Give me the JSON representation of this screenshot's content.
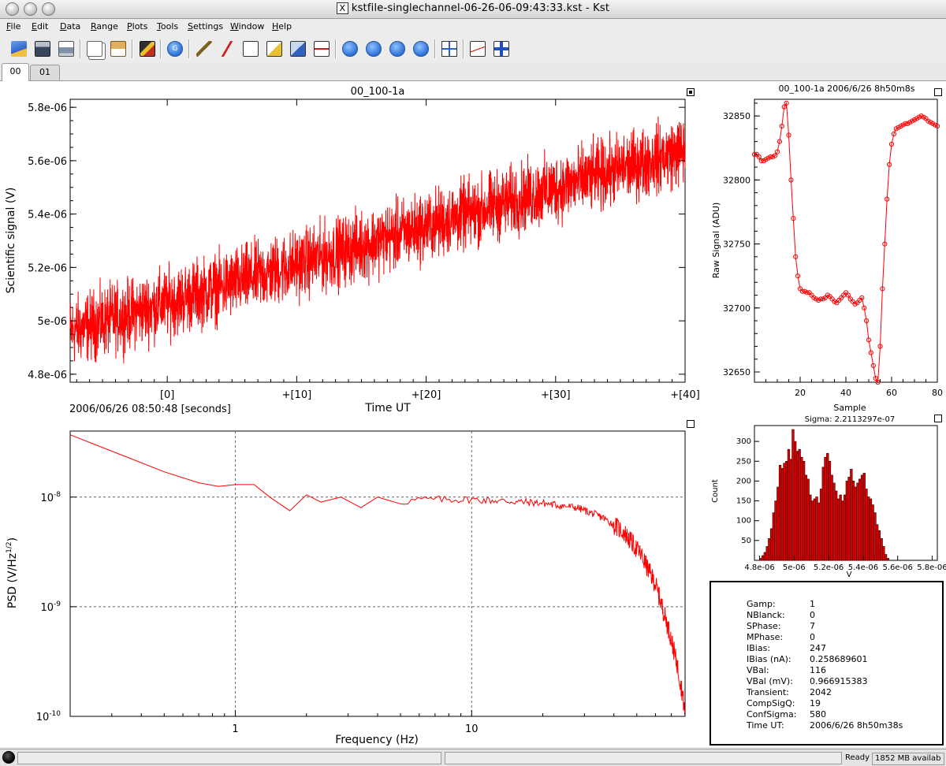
{
  "window": {
    "title": "kstfile-singlechannel-06-26-06-09:43:33.kst - Kst",
    "x_glyph": "X"
  },
  "menu": [
    "File",
    "Edit",
    "Data",
    "Range",
    "Plots",
    "Tools",
    "Settings",
    "Window",
    "Help"
  ],
  "toolbar": {
    "icons": [
      "open-icon",
      "save-icon",
      "print-icon",
      "copy-icon",
      "paste-icon",
      "export-icon",
      "reload-icon",
      "data-wizard-icon",
      "new-curve-icon",
      "new-plugin-icon",
      "new-equation-icon",
      "edit-icon",
      "layout-icon",
      "first-icon",
      "forward-icon",
      "pause-icon",
      "last-icon",
      "grid-icon",
      "zoom-icon",
      "layout-mode-icon"
    ],
    "reload_glyph": "G"
  },
  "tabs": [
    {
      "label": "00",
      "active": true
    },
    {
      "label": "01",
      "active": false
    }
  ],
  "plots": {
    "timeseries": {
      "title": "00_100-1a",
      "xlabel": "Time UT",
      "ylabel": "Scientific signal (V)",
      "date_label": "2006/06/26 08:50:48 [seconds]",
      "x_ticks": [
        "[0]",
        "+[10]",
        "+[20]",
        "+[30]",
        "+[40]"
      ],
      "y_ticks": [
        "4.8e-06",
        "5e-06",
        "5.2e-06",
        "5.4e-06",
        "5.6e-06",
        "5.8e-06"
      ],
      "color": "#ff0000"
    },
    "psd": {
      "xlabel": "Frequency (Hz)",
      "ylabel_main": "PSD (V/Hz",
      "ylabel_sup": "1/2",
      "ylabel_end": ")",
      "x_ticks": [
        "1",
        "10"
      ],
      "y_ticks": [
        {
          "base": "10",
          "exp": "-8"
        },
        {
          "base": "10",
          "exp": "-9"
        },
        {
          "base": "10",
          "exp": "-10"
        }
      ],
      "color": "#ff0000"
    },
    "raw": {
      "title": "00_100-1a 2006/6/26 8h50m8s",
      "xlabel": "Sample",
      "ylabel": "Raw Signal (ADU)",
      "x_ticks": [
        "20",
        "40",
        "60",
        "80"
      ],
      "y_ticks": [
        "32650",
        "32700",
        "32750",
        "32800",
        "32850"
      ],
      "color": "#ff0000"
    },
    "histogram": {
      "title": "Sigma: 2.2113297e-07",
      "xlabel": "V",
      "ylabel": "Count",
      "x_ticks": [
        "4.8e-06",
        "5e-06",
        "5.2e-06",
        "5.4e-06",
        "5.6e-06",
        "5.8e-06"
      ],
      "y_ticks": [
        "50",
        "100",
        "150",
        "200",
        "250",
        "300"
      ],
      "color": "#dd0000"
    }
  },
  "chart_data": [
    {
      "type": "line",
      "title": "00_100-1a",
      "xlabel": "Time UT",
      "ylabel": "Scientific signal (V)",
      "xlim": [
        -7.5,
        40
      ],
      "ylim": [
        4.77e-06,
        5.83e-06
      ],
      "trend": {
        "x": [
          -7.5,
          40
        ],
        "y": [
          4.96e-06,
          5.64e-06
        ]
      },
      "noise_amplitude": 9e-08,
      "grid": false
    },
    {
      "type": "line",
      "xlabel": "Frequency (Hz)",
      "ylabel": "PSD (V/Hz^1/2)",
      "x_scale": "log",
      "y_scale": "log",
      "xlim": [
        0.2,
        80
      ],
      "ylim": [
        1e-10,
        4e-08
      ],
      "x": [
        0.2,
        0.35,
        0.5,
        0.7,
        0.85,
        1.0,
        1.2,
        1.4,
        1.7,
        2.0,
        2.3,
        2.8,
        3.4,
        4.0,
        5.0,
        6.0,
        8.0,
        10.0,
        14.0,
        20.0,
        28.0,
        36.0,
        44.0,
        52.0,
        60.0,
        66.0,
        70.0,
        74.0,
        78.0,
        80.0
      ],
      "y": [
        3.7e-08,
        2.3e-08,
        1.7e-08,
        1.35e-08,
        1.25e-08,
        1.3e-08,
        1.3e-08,
        1e-08,
        7.5e-09,
        1.05e-08,
        9e-09,
        1e-08,
        8e-09,
        1e-08,
        9e-09,
        9.5e-09,
        9.5e-09,
        9.5e-09,
        9.2e-09,
        8.8e-09,
        8e-09,
        6.5e-09,
        4.8e-09,
        3e-09,
        1.6e-09,
        8e-10,
        5e-10,
        3e-10,
        1.6e-10,
        1e-10
      ],
      "grid": true
    },
    {
      "type": "line",
      "title": "00_100-1a 2006/6/26 8h50m8s",
      "xlabel": "Sample",
      "ylabel": "Raw Signal (ADU)",
      "xlim": [
        0,
        80
      ],
      "ylim": [
        32642,
        32863
      ],
      "x": [
        0,
        1,
        2,
        3,
        4,
        5,
        6,
        7,
        8,
        9,
        10,
        11,
        12,
        13,
        14,
        15,
        16,
        17,
        18,
        19,
        20,
        21,
        22,
        23,
        24,
        25,
        26,
        27,
        28,
        29,
        30,
        31,
        32,
        33,
        34,
        35,
        36,
        37,
        38,
        39,
        40,
        41,
        42,
        43,
        44,
        45,
        46,
        47,
        48,
        49,
        50,
        51,
        52,
        53,
        54,
        55,
        56,
        57,
        58,
        59,
        60,
        61,
        62,
        63,
        64,
        65,
        66,
        67,
        68,
        69,
        70,
        71,
        72,
        73,
        74,
        75,
        76,
        77,
        78,
        79,
        80
      ],
      "y": [
        32820,
        32820,
        32818,
        32815,
        32815,
        32816,
        32817,
        32818,
        32818,
        32819,
        32822,
        32830,
        32842,
        32857,
        32860,
        32835,
        32800,
        32770,
        32740,
        32725,
        32715,
        32713,
        32713,
        32712,
        32712,
        32710,
        32708,
        32707,
        32706,
        32707,
        32707,
        32708,
        32710,
        32709,
        32707,
        32705,
        32704,
        32706,
        32708,
        32710,
        32712,
        32710,
        32707,
        32705,
        32703,
        32704,
        32706,
        32708,
        32700,
        32690,
        32675,
        32665,
        32655,
        32645,
        32640,
        32670,
        32715,
        32750,
        32785,
        32812,
        32828,
        32836,
        32840,
        32841,
        32842,
        32843,
        32844,
        32844,
        32845,
        32846,
        32847,
        32848,
        32849,
        32850,
        32849,
        32848,
        32846,
        32845,
        32844,
        32843,
        32842
      ],
      "marker": "circle",
      "grid": false
    },
    {
      "type": "bar",
      "title": "Sigma: 2.2113297e-07",
      "xlabel": "V",
      "ylabel": "Count",
      "xlim": [
        4.77e-06,
        5.83e-06
      ],
      "ylim": [
        0,
        340
      ],
      "bin_start": 4.8e-06,
      "bin_width": 1.25e-08,
      "values": [
        5,
        12,
        20,
        35,
        55,
        80,
        120,
        150,
        185,
        240,
        232,
        245,
        250,
        280,
        255,
        330,
        300,
        275,
        280,
        260,
        250,
        215,
        205,
        165,
        150,
        155,
        160,
        145,
        180,
        235,
        260,
        270,
        250,
        215,
        195,
        175,
        155,
        165,
        150,
        165,
        200,
        210,
        230,
        200,
        185,
        195,
        205,
        215,
        220,
        180,
        160,
        155,
        140,
        120,
        90,
        75,
        55,
        35,
        15,
        5
      ],
      "grid": false
    }
  ],
  "info_panel": {
    "rows": [
      {
        "key": "Gamp:",
        "value": "1"
      },
      {
        "key": "NBlanck:",
        "value": "0"
      },
      {
        "key": "SPhase:",
        "value": "7"
      },
      {
        "key": "MPhase:",
        "value": "0"
      },
      {
        "key": "IBias:",
        "value": "247"
      },
      {
        "key": "IBias (nA):",
        "value": "0.258689601"
      },
      {
        "key": "VBal:",
        "value": "116"
      },
      {
        "key": "VBal (mV):",
        "value": "0.966915383"
      },
      {
        "key": "Transient:",
        "value": "2042"
      },
      {
        "key": "CompSigQ:",
        "value": "19"
      },
      {
        "key": "ConfSigma:",
        "value": "580"
      },
      {
        "key": "Time UT:",
        "value": " 2006/6/26 8h50m38s"
      }
    ]
  },
  "status": {
    "ready": "Ready",
    "memory": "1852 MB availab"
  }
}
